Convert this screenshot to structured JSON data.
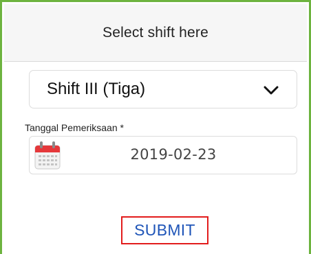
{
  "header": {
    "title": "Select shift here"
  },
  "shift_select": {
    "value": "Shift III (Tiga)",
    "icon": "chevron-down-icon"
  },
  "date_field": {
    "label": "Tanggal Pemeriksaan *",
    "value": "2019-02-23",
    "icon": "calendar-icon"
  },
  "actions": {
    "submit_label": "SUBMIT"
  },
  "colors": {
    "frame_border": "#6db33f",
    "submit_text": "#1f55b8",
    "submit_border": "#e21b1b",
    "calendar_red": "#e5383b"
  }
}
